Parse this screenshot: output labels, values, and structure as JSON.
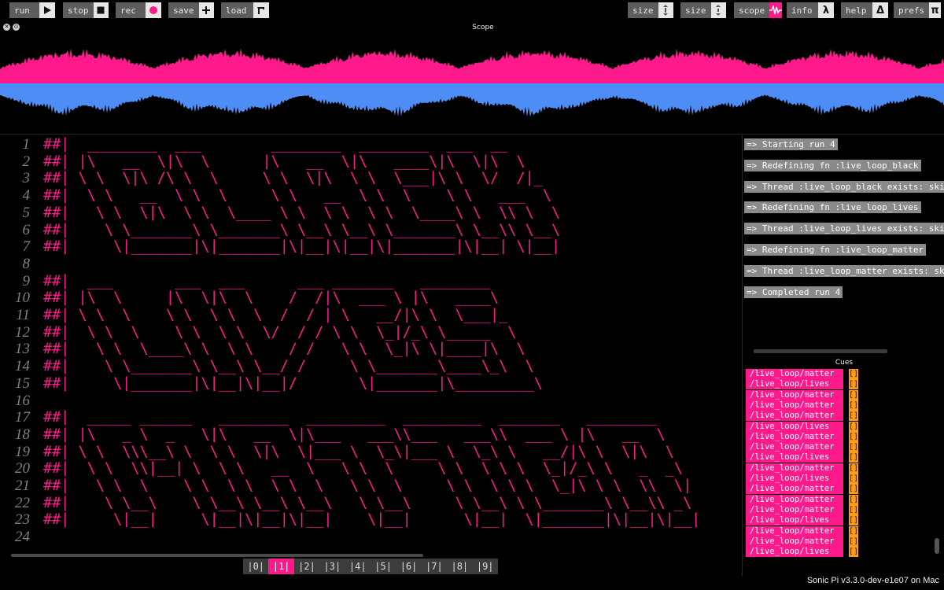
{
  "toolbar": {
    "run": {
      "label": "run",
      "icon": "play-icon"
    },
    "stop": {
      "label": "stop",
      "icon": "stop-icon"
    },
    "rec": {
      "label": "rec",
      "icon": "record-icon"
    },
    "save": {
      "label": "save",
      "icon": "plus-icon"
    },
    "load": {
      "label": "load",
      "icon": "load-icon"
    },
    "size_text": {
      "label": "size",
      "icon": "text-size-icon"
    },
    "size_interface": {
      "label": "size",
      "icon": "interface-size-icon"
    },
    "scope": {
      "label": "scope",
      "icon": "scope-wave-icon"
    },
    "info": {
      "label": "info",
      "icon": "lambda-icon",
      "glyph": "λ"
    },
    "help": {
      "label": "help",
      "icon": "delta-icon",
      "glyph": "Δ"
    },
    "prefs": {
      "label": "prefs",
      "icon": "pi-icon",
      "glyph": "π"
    }
  },
  "scope": {
    "title": "Scope",
    "top_color": "#ff1a8c",
    "bottom_color": "#4d8df5"
  },
  "editor": {
    "lines": [
      {
        "n": "1",
        "text": "##|  ________  ___        ________  ________  ___  __"
      },
      {
        "n": "2",
        "text": "##| |\\   __  \\|\\  \\      |\\   __  \\|\\   ____\\|\\  \\|\\  \\"
      },
      {
        "n": "3",
        "text": "##| \\ \\  \\|\\ /\\ \\  \\     \\ \\  \\|\\  \\ \\  \\___|\\ \\  \\/  /|_"
      },
      {
        "n": "4",
        "text": "##|  \\ \\   __  \\ \\  \\     \\ \\   __  \\ \\  \\    \\ \\   ___  \\"
      },
      {
        "n": "5",
        "text": "##|   \\ \\  \\|\\  \\ \\  \\____ \\ \\  \\ \\  \\ \\  \\____\\ \\  \\\\ \\  \\"
      },
      {
        "n": "6",
        "text": "##|    \\ \\_______\\ \\_______\\ \\__\\ \\__\\ \\_______\\ \\__\\\\ \\__\\"
      },
      {
        "n": "7",
        "text": "##|     \\|_______|\\|_______|\\|__|\\|__|\\|_______|\\|__| \\|__|"
      },
      {
        "n": "8",
        "text": ""
      },
      {
        "n": "9",
        "text": "##|  ___       ___  ___      ___ _______   ________"
      },
      {
        "n": "10",
        "text": "##| |\\  \\     |\\  \\|\\  \\    /  /|\\  ___ \\ |\\   ____\\"
      },
      {
        "n": "11",
        "text": "##| \\ \\  \\    \\ \\  \\ \\  \\  /  / | \\   __/|\\ \\  \\___|_"
      },
      {
        "n": "12",
        "text": "##|  \\ \\  \\    \\ \\  \\ \\  \\/  / / \\ \\  \\_|/_\\ \\_____  \\"
      },
      {
        "n": "13",
        "text": "##|   \\ \\  \\____\\ \\  \\ \\    / /   \\ \\  \\_|\\ \\|____|\\  \\"
      },
      {
        "n": "14",
        "text": "##|    \\ \\_______\\ \\__\\ \\__/ /     \\ \\_______\\____\\_\\  \\"
      },
      {
        "n": "15",
        "text": "##|     \\|_______|\\|__|\\|__|/       \\|_______|\\_________\\"
      },
      {
        "n": "16",
        "text": ""
      },
      {
        "n": "17",
        "text": "##|  _____ ______   ________  _________  _________  _______   ________"
      },
      {
        "n": "18",
        "text": "##| |\\   _ \\  _   \\|\\   __  \\|\\___   ___\\\\___   ___\\\\  ___ \\ |\\   __  \\"
      },
      {
        "n": "19",
        "text": "##| \\ \\  \\\\\\__\\ \\  \\ \\  \\|\\  \\|___ \\  \\_\\|___ \\  \\_\\ \\   __/|\\ \\  \\|\\  \\"
      },
      {
        "n": "20",
        "text": "##|  \\ \\  \\\\|__| \\  \\ \\   __  \\   \\ \\  \\     \\ \\  \\ \\ \\  \\_|/_\\ \\   _  _\\"
      },
      {
        "n": "21",
        "text": "##|   \\ \\  \\    \\ \\  \\ \\  \\ \\  \\   \\ \\  \\     \\ \\  \\ \\ \\  \\_|\\ \\ \\  \\\\  \\|"
      },
      {
        "n": "22",
        "text": "##|    \\ \\__\\    \\ \\__\\ \\__\\ \\__\\   \\ \\__\\     \\ \\__\\ \\ \\_______\\ \\__\\\\ _\\"
      },
      {
        "n": "23",
        "text": "##|     \\|__|     \\|__|\\|__|\\|__|    \\|__|      \\|__|  \\|_______|\\|__|\\|__|"
      },
      {
        "n": "24",
        "text": ""
      }
    ]
  },
  "buffers": [
    "|0|",
    "|1|",
    "|2|",
    "|3|",
    "|4|",
    "|5|",
    "|6|",
    "|7|",
    "|8|",
    "|9|"
  ],
  "active_buffer": 1,
  "log": [
    "=> Starting run 4",
    "=> Redefining fn :live_loop_black",
    "=> Thread :live_loop_black exists: skipping creation",
    "=> Redefining fn :live_loop_lives",
    "=> Thread :live_loop_lives exists: skipping creation",
    "=> Redefining fn :live_loop_matter",
    "=> Thread :live_loop_matter exists: skipping creation",
    "=> Completed run 4"
  ],
  "cues_title": "Cues",
  "cues": [
    {
      "path": "/live_loop/matter",
      "value": "[]"
    },
    {
      "path": "/live_loop/lives",
      "value": "[]"
    },
    {
      "path": "/live_loop/matter",
      "value": "[]"
    },
    {
      "path": "/live_loop/matter",
      "value": "[]"
    },
    {
      "path": "/live_loop/matter",
      "value": "[]"
    },
    {
      "path": "/live_loop/lives",
      "value": "[]"
    },
    {
      "path": "/live_loop/matter",
      "value": "[]"
    },
    {
      "path": "/live_loop/matter",
      "value": "[]"
    },
    {
      "path": "/live_loop/lives",
      "value": "[]"
    },
    {
      "path": "/live_loop/matter",
      "value": "[]"
    },
    {
      "path": "/live_loop/lives",
      "value": "[]"
    },
    {
      "path": "/live_loop/matter",
      "value": "[]"
    },
    {
      "path": "/live_loop/matter",
      "value": "[]"
    },
    {
      "path": "/live_loop/matter",
      "value": "[]"
    },
    {
      "path": "/live_loop/lives",
      "value": "[]"
    },
    {
      "path": "/live_loop/matter",
      "value": "[]"
    },
    {
      "path": "/live_loop/matter",
      "value": "[]"
    },
    {
      "path": "/live_loop/lives",
      "value": "[]"
    }
  ],
  "status": "Sonic Pi v3.3.0-dev-e1e07 on Mac"
}
